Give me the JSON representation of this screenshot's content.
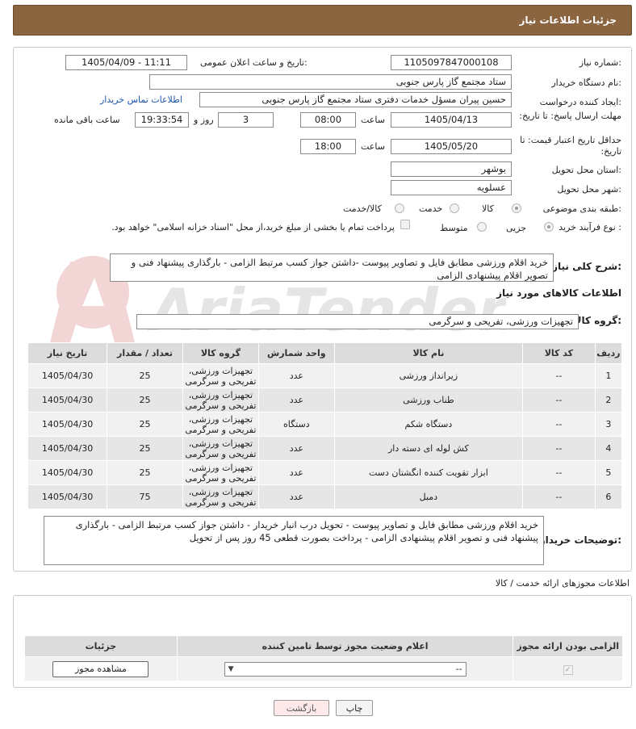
{
  "header": {
    "title": "جزئیات اطلاعات نیاز"
  },
  "fields": {
    "need_number_label": "شماره نیاز:",
    "need_number": "1105097847000108",
    "announce_label": "تاریخ و ساعت اعلان عمومی:",
    "announce_value": "1405/04/09 - 11:11",
    "buyer_org_label": "نام دستگاه خریدار:",
    "buyer_org": "ستاد مجتمع گاز پارس جنوبی",
    "creator_label": "ایجاد کننده درخواست:",
    "creator": "حسین پیران مسؤل خدمات دفتری ستاد مجتمع گاز پارس جنوبی",
    "buyer_contact_link": "اطلاعات تماس خریدار",
    "reply_deadline_label": "مهلت ارسال پاسخ: تا تاریخ:",
    "reply_date": "1405/04/13",
    "time_label": "ساعت",
    "reply_time": "08:00",
    "days": "3",
    "day_label": "روز و",
    "remaining_time": "19:33:54",
    "remaining_label": "ساعت باقی مانده",
    "price_deadline_label": "حداقل تاریخ اعتبار قیمت: تا تاریخ:",
    "price_date": "1405/05/20",
    "price_time": "18:00",
    "province_label": "استان محل تحویل:",
    "province": "بوشهر",
    "city_label": "شهر محل تحویل:",
    "city": "عسلویه",
    "category_label": "طبقه بندی موضوعی:",
    "category_options": [
      "کالا",
      "خدمت",
      "کالا/خدمت"
    ],
    "process_label": "نوع فرآیند خرید :",
    "process_options": [
      "جزیی",
      "متوسط"
    ],
    "payment_note": "پرداخت تمام یا بخشی از مبلغ خرید،از محل \"اسناد خزانه اسلامی\" خواهد بود."
  },
  "description": {
    "label": "شرح کلی نیاز:",
    "text": "خرید اقلام ورزشی مطابق فایل و تصاویر پیوست -داشتن جواز کسب مرتبط الزامی - بارگذاری پیشنهاد فنی و تصویر اقلام پیشنهادی الزامی"
  },
  "goods": {
    "section_title": "اطلاعات کالاهای مورد نیاز",
    "group_label": "گروه کالا:",
    "group_value": "تجهیزات ورزشی، تفریحی و سرگرمی",
    "columns": [
      "ردیف",
      "کد کالا",
      "نام کالا",
      "واحد شمارش",
      "گروه کالا",
      "تعداد / مقدار",
      "تاریخ نیاز"
    ],
    "rows": [
      {
        "n": "1",
        "code": "--",
        "name": "زیرانداز ورزشی",
        "unit": "عدد",
        "group": "تجهیزات ورزشی، تفریحی و سرگرمی",
        "qty": "25",
        "date": "1405/04/30"
      },
      {
        "n": "2",
        "code": "--",
        "name": "طناب ورزشی",
        "unit": "عدد",
        "group": "تجهیزات ورزشی، تفریحی و سرگرمی",
        "qty": "25",
        "date": "1405/04/30"
      },
      {
        "n": "3",
        "code": "--",
        "name": "دستگاه شکم",
        "unit": "دستگاه",
        "group": "تجهیزات ورزشی، تفریحی و سرگرمی",
        "qty": "25",
        "date": "1405/04/30"
      },
      {
        "n": "4",
        "code": "--",
        "name": "کش لوله ای دسته دار",
        "unit": "عدد",
        "group": "تجهیزات ورزشی، تفریحی و سرگرمی",
        "qty": "25",
        "date": "1405/04/30"
      },
      {
        "n": "5",
        "code": "--",
        "name": "ابزار تقویت کننده انگشتان دست",
        "unit": "عدد",
        "group": "تجهیزات ورزشی، تفریحی و سرگرمی",
        "qty": "25",
        "date": "1405/04/30"
      },
      {
        "n": "6",
        "code": "--",
        "name": "دمبل",
        "unit": "عدد",
        "group": "تجهیزات ورزشی، تفریحی و سرگرمی",
        "qty": "75",
        "date": "1405/04/30"
      }
    ],
    "buyer_notes_label": "توضیحات خریدار:",
    "buyer_notes": "خرید اقلام ورزشی مطابق فایل و تصاویر پیوست - تحویل درب انبار خریدار - داشتن جواز کسب مرتبط الزامی - بارگذاری پیشنهاد فنی و تصویر اقلام پیشنهادی الزامی - پرداخت بصورت قطعی 45 روز پس از تحویل"
  },
  "permits": {
    "section_title": "اطلاعات مجوزهای ارائه خدمت / کالا",
    "columns": [
      "الزامی بودن ارائه مجوز",
      "اعلام وضعیت مجوز توسط تامین کننده",
      "جزئیات"
    ],
    "select_value": "--",
    "view_button": "مشاهده مجوز"
  },
  "footer": {
    "print_button": "چاپ",
    "back_button": "بازگشت"
  },
  "watermark_text": "AriaTender.neT"
}
